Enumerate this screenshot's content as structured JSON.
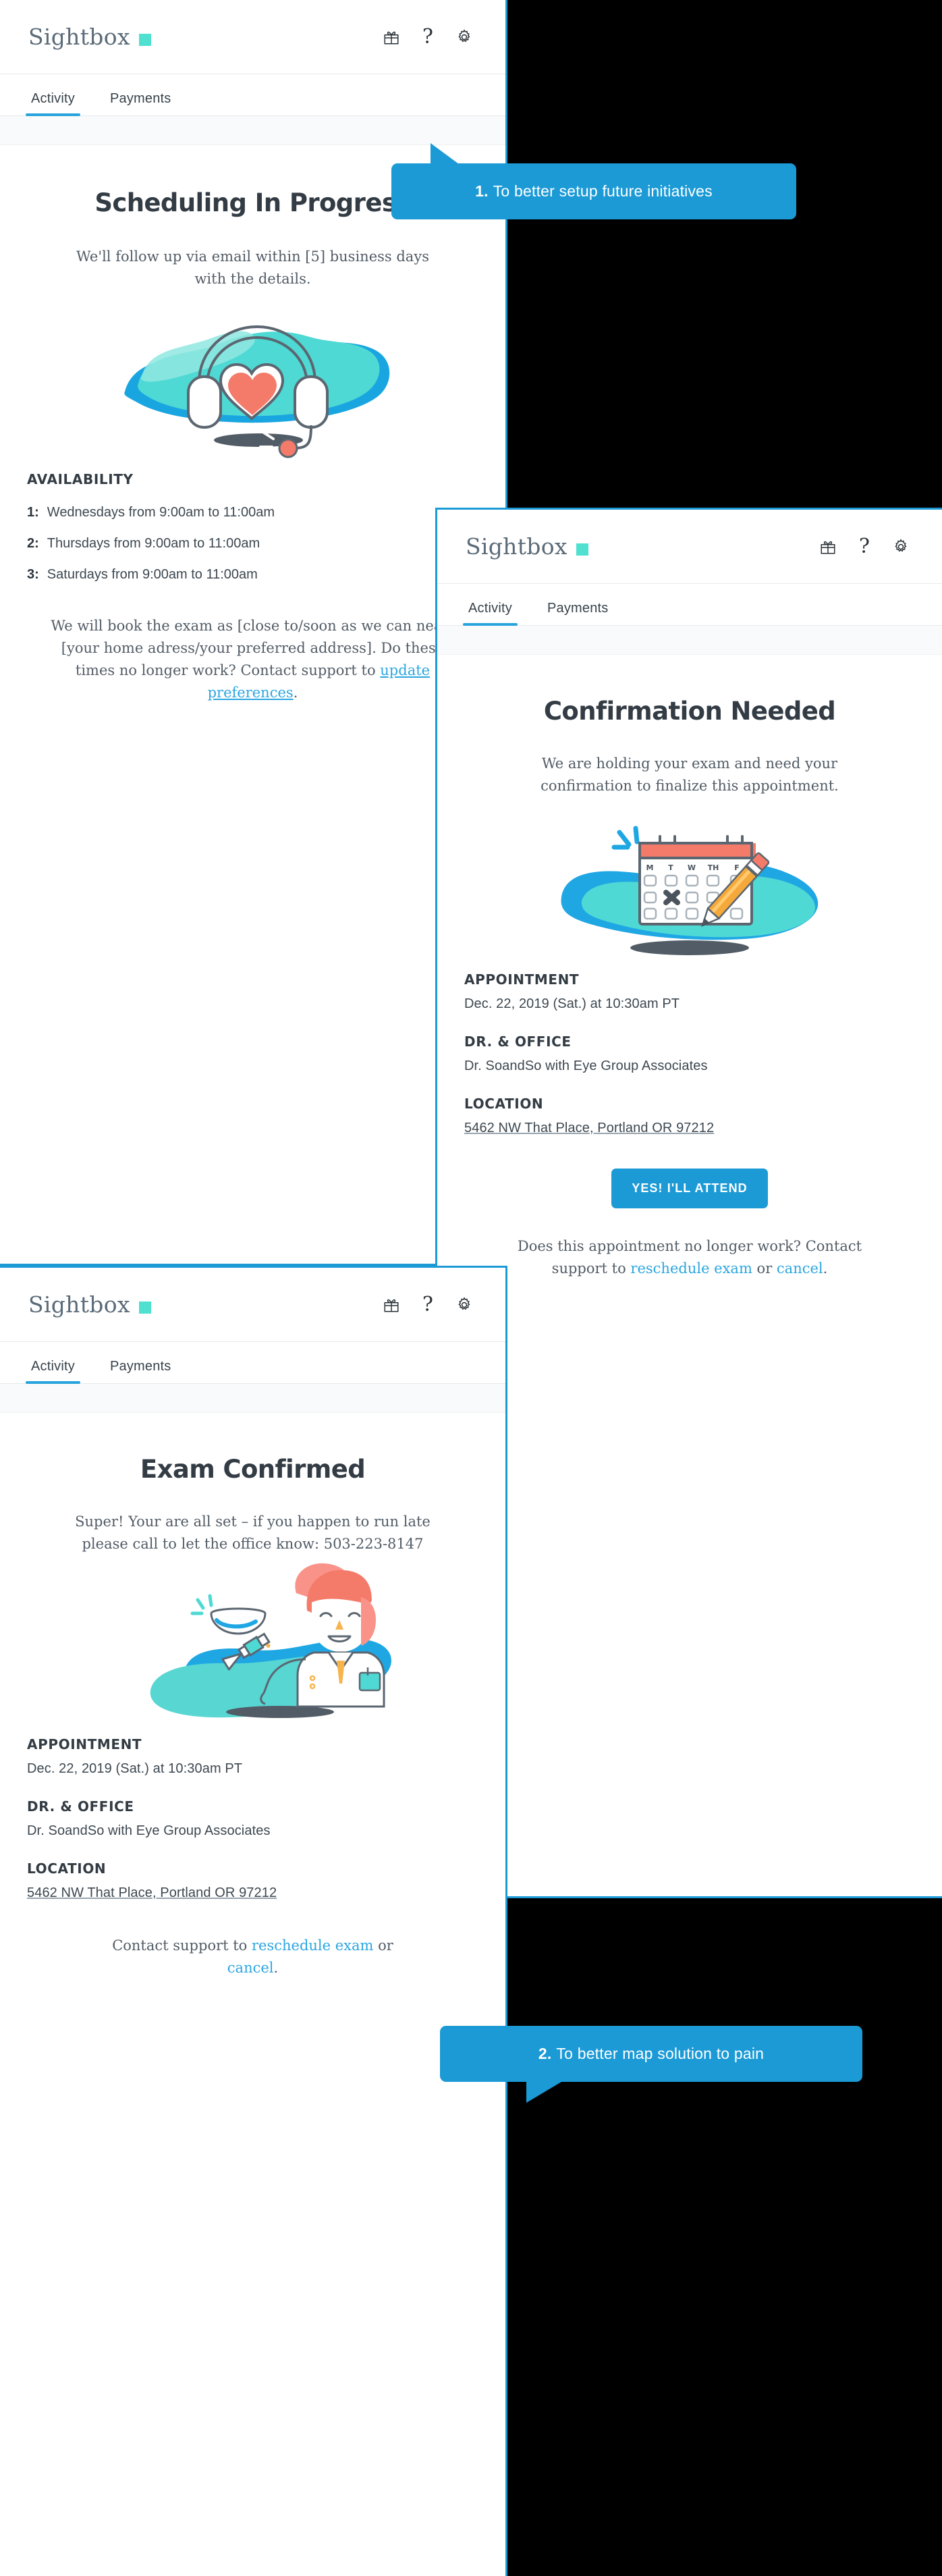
{
  "brand": {
    "name": "Sightbox",
    "square_color": "#4fe0d0"
  },
  "appbar": {
    "gift_icon": "gift-icon",
    "help_label": "?",
    "settings_icon": "gear-icon"
  },
  "tabs": [
    {
      "label": "Activity",
      "active": true
    },
    {
      "label": "Payments",
      "active": false
    }
  ],
  "colors": {
    "accent_blue": "#1b9ad6",
    "link_blue": "#2ba6e0",
    "teal": "#4fe0d0",
    "coral": "#f47b6a",
    "text_dark": "#333c44"
  },
  "card1": {
    "title": "Scheduling In Progress",
    "intro": "We'll follow up via email within [5] business days with the details.",
    "illustration": "headset-heart-support-illustration",
    "availability_label": "AVAILABILITY",
    "availability": [
      {
        "n": "1:",
        "text": "Wednesdays from 9:00am to 11:00am"
      },
      {
        "n": "2:",
        "text": "Thursdays from 9:00am to 11:00am"
      },
      {
        "n": "3:",
        "text": "Saturdays from 9:00am to 11:00am"
      }
    ],
    "footer_text_before": "We will book the exam as [close to/soon as we can near] [your home adress/your preferred address].  Do these times no longer work? Contact support to ",
    "footer_link": "update preferences",
    "footer_text_after": "."
  },
  "card2": {
    "title": "Confirmation Needed",
    "intro": "We are holding your exam and need your confirmation to finalize this appointment.",
    "illustration": "calendar-pencil-illustration",
    "details": [
      {
        "label": "APPOINTMENT",
        "value": "Dec. 22, 2019 (Sat.) at 10:30am PT",
        "underlined": false
      },
      {
        "label": "DR. & OFFICE",
        "value": "Dr. SoandSo with Eye Group Associates",
        "underlined": false
      },
      {
        "label": "LOCATION",
        "value": "5462 NW That Place, Portland OR 97212",
        "underlined": true
      }
    ],
    "cta_label": "YES!  I'LL ATTEND",
    "footer_text_before": "Does this appointment no longer work? Contact support to ",
    "footer_link_1": "reschedule exam",
    "footer_mid": " or ",
    "footer_link_2": "cancel",
    "footer_text_after": "."
  },
  "card3": {
    "title": "Exam Confirmed",
    "intro": "Super!  Your are all set – if you happen to run late please call to let the office know:  503-223-8147",
    "illustration": "optometrist-contact-lens-illustration",
    "details": [
      {
        "label": "APPOINTMENT",
        "value": "Dec. 22, 2019 (Sat.) at 10:30am PT",
        "underlined": false
      },
      {
        "label": "DR. & OFFICE",
        "value": "Dr. SoandSo with Eye Group Associates",
        "underlined": false
      },
      {
        "label": "LOCATION",
        "value": "5462 NW That Place, Portland OR 97212",
        "underlined": true
      }
    ],
    "footer_text_before": "Contact support to ",
    "footer_link_1": "reschedule exam",
    "footer_mid": " or ",
    "footer_link_2": "cancel",
    "footer_text_after": "."
  },
  "callouts": [
    {
      "number": "1.",
      "text": "To better setup future initiatives"
    },
    {
      "number": "2.",
      "text": "To better map solution to pain"
    }
  ]
}
